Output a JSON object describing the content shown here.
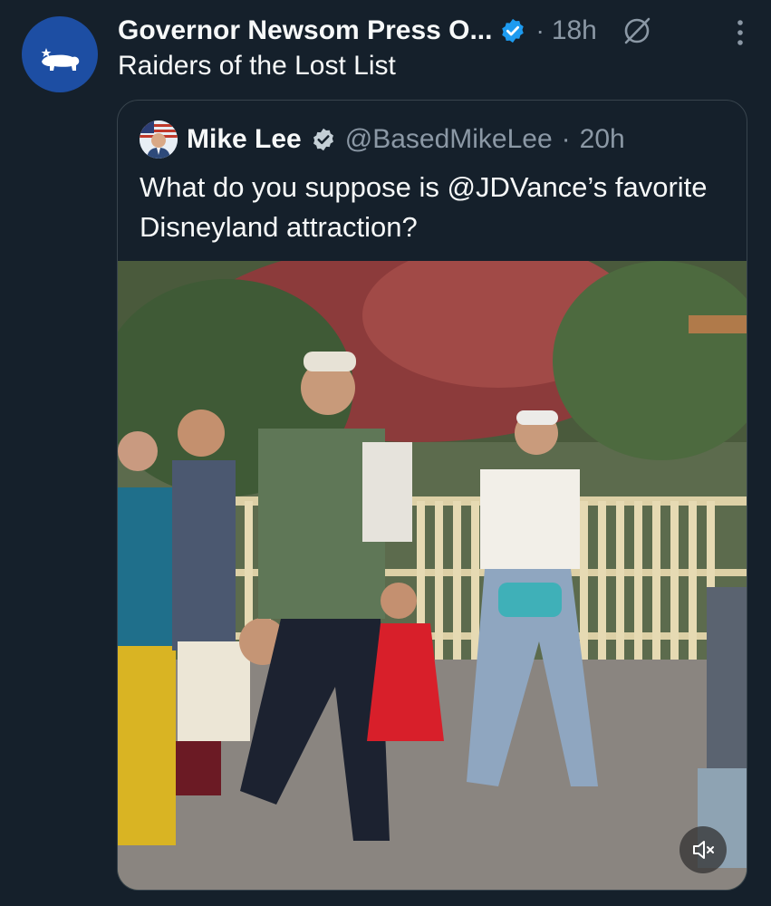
{
  "tweet": {
    "author_name": "Governor Newsom Press O...",
    "separator": "·",
    "timestamp": "18h",
    "text": "Raiders of the Lost List",
    "avatar_icon": "california-bear-icon",
    "brand_color": "#1d4ea3"
  },
  "quote": {
    "author_name": "Mike Lee",
    "handle": "@BasedMikeLee",
    "separator": "·",
    "timestamp": "20h",
    "text": "What do you suppose is @JDVance’s favorite Disneyland attraction?"
  },
  "media": {
    "type": "video",
    "mute_icon": "speaker-muted-icon"
  },
  "colors": {
    "background": "#15202b",
    "text": "#f7f9f9",
    "secondary_text": "#8b98a5",
    "verified": "#1d9bf0",
    "border": "#38444d"
  }
}
